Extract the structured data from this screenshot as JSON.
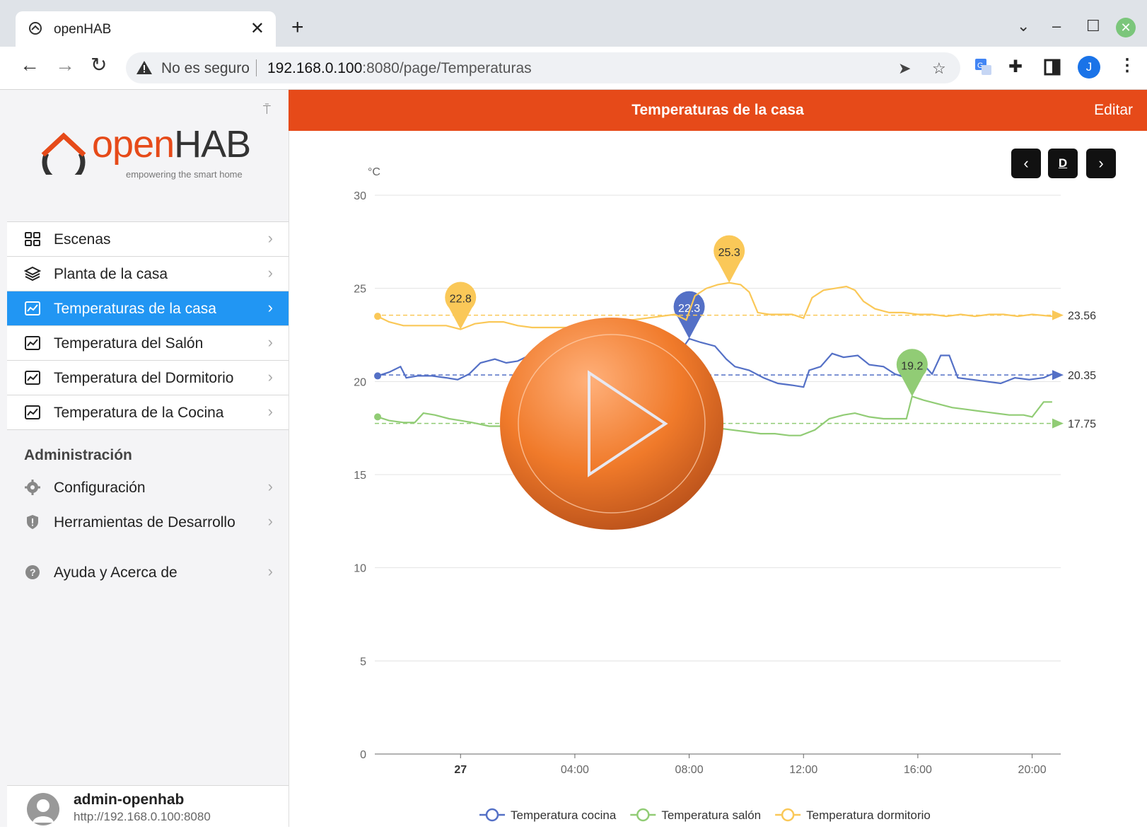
{
  "browser": {
    "tab_title": "openHAB",
    "tab_close": "✕",
    "new_tab": "+",
    "not_secure": "No es seguro",
    "url_host": "192.168.0.100",
    "url_rest": ":8080/page/Temperaturas",
    "profile_initial": "J"
  },
  "sidebar": {
    "logo_open": "open",
    "logo_hab": "HAB",
    "logo_tagline": "empowering the smart home",
    "items": [
      {
        "label": "Escenas",
        "icon": "grid-icon"
      },
      {
        "label": "Planta de la casa",
        "icon": "layers-icon"
      },
      {
        "label": "Temperaturas de la casa",
        "icon": "chart-icon",
        "active": true
      },
      {
        "label": "Temperatura del Salón",
        "icon": "chart-icon"
      },
      {
        "label": "Temperatura del Dormitorio",
        "icon": "chart-icon"
      },
      {
        "label": "Temperatura de la Cocina",
        "icon": "chart-icon"
      }
    ],
    "admin_title": "Administración",
    "admin_items": [
      {
        "label": "Configuración",
        "icon": "gear-icon"
      },
      {
        "label": "Herramientas de Desarrollo",
        "icon": "shield-icon"
      },
      {
        "label": "Ayuda y Acerca de",
        "icon": "help-icon"
      }
    ],
    "user_name": "admin-openhab",
    "user_url": "http://192.168.0.100:8080"
  },
  "page": {
    "title": "Temperaturas de la casa",
    "edit": "Editar",
    "period_prev": "‹",
    "period_label": "D",
    "period_next": "›"
  },
  "chart_data": {
    "type": "line",
    "ylabel": "°C",
    "ylim": [
      0,
      30
    ],
    "yticks": [
      0,
      5,
      10,
      15,
      20,
      25,
      30
    ],
    "xticks": [
      "27",
      "04:00",
      "08:00",
      "12:00",
      "16:00",
      "20:00"
    ],
    "grid": true,
    "legend_position": "bottom",
    "series": [
      {
        "name": "Temperatura cocina",
        "color": "#5470c6",
        "markpoint_label": "22.3",
        "average_label": "20.35",
        "average": 20.35,
        "values": [
          [
            -2.9,
            20.3
          ],
          [
            -2.5,
            20.5
          ],
          [
            -2.1,
            20.8
          ],
          [
            -1.9,
            20.2
          ],
          [
            -1.5,
            20.3
          ],
          [
            -1.0,
            20.3
          ],
          [
            -0.5,
            20.2
          ],
          [
            -0.1,
            20.1
          ],
          [
            0.3,
            20.4
          ],
          [
            0.7,
            21.0
          ],
          [
            1.2,
            21.2
          ],
          [
            1.6,
            21.0
          ],
          [
            2.0,
            21.1
          ],
          [
            2.4,
            21.4
          ],
          [
            2.8,
            21.4
          ],
          [
            3.2,
            21.3
          ],
          [
            3.6,
            21.4
          ],
          [
            4.1,
            21.2
          ],
          [
            4.6,
            21.0
          ],
          [
            5.1,
            21.1
          ],
          [
            5.6,
            21.0
          ],
          [
            6.1,
            20.9
          ],
          [
            6.6,
            20.8
          ],
          [
            7.1,
            21.0
          ],
          [
            7.6,
            21.4
          ],
          [
            8.0,
            22.3
          ],
          [
            8.4,
            22.1
          ],
          [
            8.9,
            21.9
          ],
          [
            9.3,
            21.2
          ],
          [
            9.6,
            20.8
          ],
          [
            10.1,
            20.6
          ],
          [
            10.6,
            20.2
          ],
          [
            11.1,
            19.9
          ],
          [
            11.6,
            19.8
          ],
          [
            12.0,
            19.7
          ],
          [
            12.2,
            20.6
          ],
          [
            12.6,
            20.8
          ],
          [
            13.0,
            21.5
          ],
          [
            13.4,
            21.3
          ],
          [
            13.9,
            21.4
          ],
          [
            14.3,
            20.9
          ],
          [
            14.8,
            20.8
          ],
          [
            15.2,
            20.4
          ],
          [
            15.6,
            20.2
          ],
          [
            16.0,
            20.2
          ],
          [
            16.2,
            20.9
          ],
          [
            16.5,
            20.4
          ],
          [
            16.8,
            21.4
          ],
          [
            17.1,
            21.4
          ],
          [
            17.4,
            20.2
          ],
          [
            17.9,
            20.1
          ],
          [
            18.4,
            20.0
          ],
          [
            18.9,
            19.9
          ],
          [
            19.4,
            20.2
          ],
          [
            19.9,
            20.1
          ],
          [
            20.4,
            20.2
          ],
          [
            20.7,
            20.4
          ]
        ]
      },
      {
        "name": "Temperatura salón",
        "color": "#91cc75",
        "markpoint_label": "19.2",
        "average_label": "17.75",
        "average": 17.75,
        "values": [
          [
            -2.9,
            18.1
          ],
          [
            -2.5,
            17.9
          ],
          [
            -2.0,
            17.8
          ],
          [
            -1.6,
            17.8
          ],
          [
            -1.3,
            18.3
          ],
          [
            -0.9,
            18.2
          ],
          [
            -0.4,
            18.0
          ],
          [
            0.0,
            17.9
          ],
          [
            0.4,
            17.8
          ],
          [
            1.0,
            17.6
          ],
          [
            1.5,
            17.6
          ],
          [
            2.0,
            17.7
          ],
          [
            2.5,
            17.8
          ],
          [
            3.0,
            17.8
          ],
          [
            3.5,
            17.8
          ],
          [
            4.0,
            17.8
          ],
          [
            4.5,
            17.8
          ],
          [
            5.0,
            17.9
          ],
          [
            5.5,
            17.8
          ],
          [
            6.0,
            17.8
          ],
          [
            6.5,
            17.7
          ],
          [
            7.0,
            17.6
          ],
          [
            7.5,
            17.6
          ],
          [
            8.0,
            17.6
          ],
          [
            8.5,
            17.5
          ],
          [
            9.0,
            17.5
          ],
          [
            9.5,
            17.4
          ],
          [
            10.0,
            17.3
          ],
          [
            10.5,
            17.2
          ],
          [
            11.0,
            17.2
          ],
          [
            11.5,
            17.1
          ],
          [
            11.9,
            17.1
          ],
          [
            12.4,
            17.4
          ],
          [
            12.9,
            18.0
          ],
          [
            13.4,
            18.2
          ],
          [
            13.8,
            18.3
          ],
          [
            14.3,
            18.1
          ],
          [
            14.8,
            18.0
          ],
          [
            15.3,
            18.0
          ],
          [
            15.6,
            18.0
          ],
          [
            15.8,
            19.2
          ],
          [
            16.2,
            19.0
          ],
          [
            16.7,
            18.8
          ],
          [
            17.2,
            18.6
          ],
          [
            17.7,
            18.5
          ],
          [
            18.2,
            18.4
          ],
          [
            18.7,
            18.3
          ],
          [
            19.2,
            18.2
          ],
          [
            19.7,
            18.2
          ],
          [
            20.0,
            18.1
          ],
          [
            20.4,
            18.9
          ],
          [
            20.7,
            18.9
          ]
        ]
      },
      {
        "name": "Temperatura dormitorio",
        "color": "#fac858",
        "markpoint_label": "25.3",
        "average_label": "23.56",
        "average": 23.56,
        "values": [
          [
            -2.9,
            23.5
          ],
          [
            -2.5,
            23.2
          ],
          [
            -2.0,
            23.0
          ],
          [
            -1.5,
            23.0
          ],
          [
            -1.0,
            23.0
          ],
          [
            -0.5,
            23.0
          ],
          [
            0.0,
            22.8
          ],
          [
            0.5,
            23.1
          ],
          [
            1.0,
            23.2
          ],
          [
            1.5,
            23.2
          ],
          [
            2.0,
            23.0
          ],
          [
            2.5,
            22.9
          ],
          [
            3.0,
            22.9
          ],
          [
            3.5,
            22.9
          ],
          [
            4.0,
            22.9
          ],
          [
            4.5,
            23.1
          ],
          [
            5.0,
            23.2
          ],
          [
            5.5,
            23.3
          ],
          [
            6.0,
            23.3
          ],
          [
            6.5,
            23.4
          ],
          [
            7.0,
            23.5
          ],
          [
            7.5,
            23.6
          ],
          [
            7.9,
            23.3
          ],
          [
            8.2,
            24.6
          ],
          [
            8.6,
            25.0
          ],
          [
            9.0,
            25.2
          ],
          [
            9.4,
            25.3
          ],
          [
            9.8,
            25.2
          ],
          [
            10.1,
            24.8
          ],
          [
            10.4,
            23.7
          ],
          [
            10.8,
            23.6
          ],
          [
            11.2,
            23.6
          ],
          [
            11.6,
            23.6
          ],
          [
            12.0,
            23.4
          ],
          [
            12.3,
            24.5
          ],
          [
            12.7,
            24.9
          ],
          [
            13.1,
            25.0
          ],
          [
            13.5,
            25.1
          ],
          [
            13.8,
            24.9
          ],
          [
            14.1,
            24.3
          ],
          [
            14.5,
            23.9
          ],
          [
            15.0,
            23.7
          ],
          [
            15.5,
            23.7
          ],
          [
            16.0,
            23.6
          ],
          [
            16.5,
            23.6
          ],
          [
            17.0,
            23.5
          ],
          [
            17.5,
            23.6
          ],
          [
            18.0,
            23.5
          ],
          [
            18.5,
            23.6
          ],
          [
            19.0,
            23.6
          ],
          [
            19.5,
            23.5
          ],
          [
            20.0,
            23.6
          ],
          [
            20.7,
            23.5
          ]
        ]
      }
    ]
  }
}
